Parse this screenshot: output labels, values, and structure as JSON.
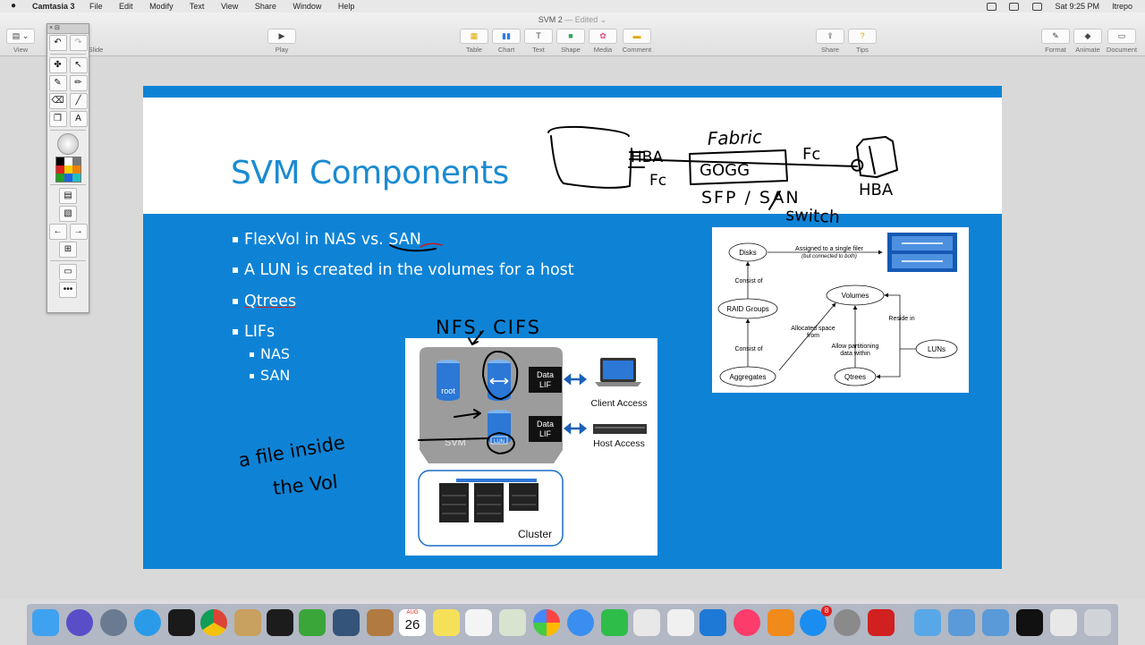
{
  "menubar": {
    "app_name": "Camtasia 3",
    "menus": [
      "File",
      "Edit",
      "Modify",
      "Text",
      "View",
      "Share",
      "Window",
      "Help"
    ],
    "clock": "Sat 9:25 PM",
    "user": "ltrepo"
  },
  "window": {
    "doc_title": "SVM 2",
    "doc_status": "— Edited ⌄"
  },
  "toolbar": {
    "view_label": "View",
    "slide_label": "Slide",
    "play_label": "Play",
    "table_label": "Table",
    "chart_label": "Chart",
    "text_label": "Text",
    "shape_label": "Shape",
    "media_label": "Media",
    "comment_label": "Comment",
    "share_label": "Share",
    "tips_label": "Tips",
    "format_label": "Format",
    "animate_label": "Animate",
    "document_label": "Document"
  },
  "slide": {
    "title": "SVM Components",
    "bullets": [
      {
        "text": "FlexVol in NAS vs. SAN",
        "level": 1
      },
      {
        "text": "A LUN is created in the volumes for a host",
        "level": 1
      },
      {
        "text": "Qtrees",
        "level": 1
      },
      {
        "text": "LIFs",
        "level": 1
      },
      {
        "text": "NAS",
        "level": 2
      },
      {
        "text": "SAN",
        "level": 2
      }
    ],
    "svm_figure": {
      "root_label": "root",
      "lun_label": "LUN",
      "svm_label": "SVM",
      "data_lif_label_1": "Data",
      "data_lif_label_2": "LIF",
      "client_access": "Client Access",
      "host_access": "Host Access",
      "cluster": "Cluster"
    },
    "diagram": {
      "disks": "Disks",
      "assigned": "Assigned to a single filer",
      "assigned_note": "(but connected to both)",
      "consist_of_1": "Consist of",
      "raid_groups": "RAID Groups",
      "consist_of_2": "Consist of",
      "aggregates": "Aggregates",
      "volumes": "Volumes",
      "allocated_1": "Allocated space",
      "allocated_2": "from",
      "allow_1": "Allow partitioning",
      "allow_2": "data within",
      "reside_in": "Reside in",
      "luns": "LUNs",
      "qtrees": "Qtrees"
    }
  },
  "annotations": {
    "fabric": "Fabric",
    "hba_left": "HBA",
    "fc_left": "Fc",
    "fc_right": "Fc",
    "switch_ports": "GOGG",
    "sfp": "SFP / SAN",
    "switch": "switch",
    "hba_right": "HBA",
    "nfs_cifs": "NFS, CIFS",
    "file_inside": "a file inside",
    "the_vol": "the Vol"
  },
  "dock": {
    "calendar_month": "AUG",
    "calendar_day": "26",
    "badge": "8"
  },
  "colors": {
    "slide_blue": "#0e83d6",
    "title_blue": "#1a8bd0",
    "pen": "#000000",
    "lif_box": "#111111",
    "arrow_blue": "#1b5fb8"
  }
}
